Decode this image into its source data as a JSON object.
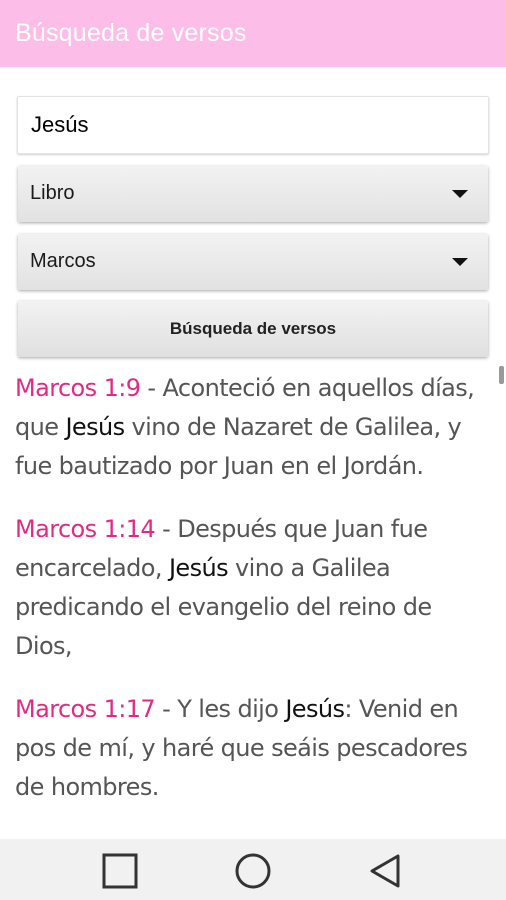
{
  "app_bar": {
    "title": "Búsqueda de versos",
    "color": "#fdbde9"
  },
  "search": {
    "value": "Jesús"
  },
  "filters": {
    "category": {
      "selected": "Libro"
    },
    "book": {
      "selected": "Marcos"
    }
  },
  "search_button": {
    "label": "Búsqueda de versos"
  },
  "results": [
    {
      "ref": "Marcos 1:9",
      "sep": " - ",
      "before": "Aconteció en aquellos días, que ",
      "keyword": "Jesús",
      "after": " vino de Nazaret de Galilea, y fue bautizado por Juan en el Jordán."
    },
    {
      "ref": "Marcos 1:14",
      "sep": " - ",
      "before": "Después que Juan fue encarcelado, ",
      "keyword": "Jesús",
      "after": " vino a Galilea predicando el evangelio del reino de Dios,"
    },
    {
      "ref": "Marcos 1:17",
      "sep": " - ",
      "before": "Y les dijo ",
      "keyword": "Jesús",
      "after": ": Venid en pos de mí, y haré que seáis pescadores de hombres."
    }
  ],
  "colors": {
    "reference": "#e22a84",
    "keyword": "#111111",
    "verse_text": "#555555"
  },
  "nav": {
    "icons": [
      "recent-apps-icon",
      "home-icon",
      "back-icon"
    ]
  }
}
